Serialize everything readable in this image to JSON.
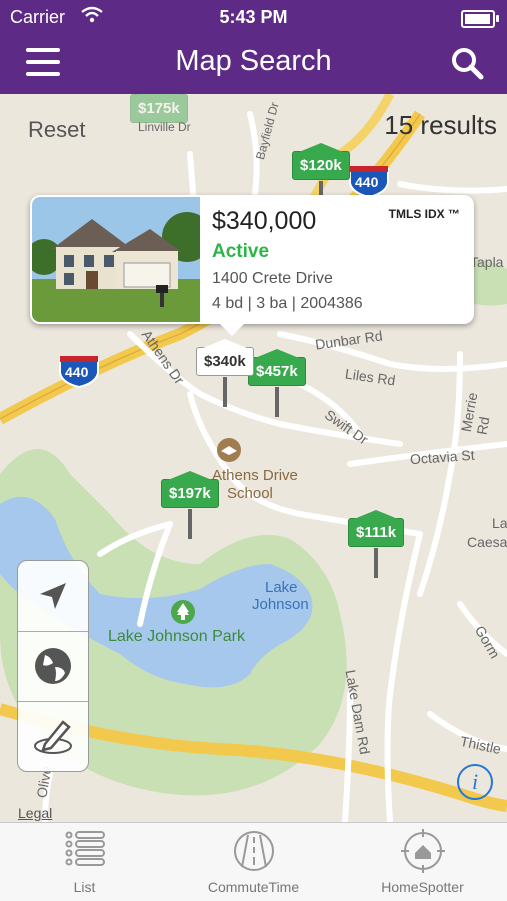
{
  "status_bar": {
    "carrier": "Carrier",
    "time": "5:43 PM",
    "battery_level": 0.95
  },
  "nav": {
    "title": "Map Search",
    "menu_icon": "hamburger-icon",
    "search_icon": "search-icon"
  },
  "map": {
    "reset_label": "Reset",
    "results_label": "15 results",
    "legal_label": "Legal",
    "labels": [
      "Dunbar Rd",
      "Liles Rd",
      "Swift Dr",
      "Octavia St",
      "Athens Dr",
      "Athens Drive",
      "School",
      "Lake",
      "Johnson",
      "Lake Johnson Park",
      "Lake Dam Rd",
      "Merrie Rd",
      "Thistle",
      "Olive",
      "440",
      "440",
      "Lake",
      "Caesa",
      "Tapla",
      "Gorm",
      "Bayfield Dr",
      "Linville Dr"
    ],
    "pins": [
      {
        "label": "$175k",
        "faded": true
      },
      {
        "label": "$120k"
      },
      {
        "label": "$340k",
        "selected": true
      },
      {
        "label": "$457k"
      },
      {
        "label": "$197k"
      },
      {
        "label": "$111k"
      }
    ],
    "popup": {
      "price": "$340,000",
      "brand": "TMLS IDX ™",
      "status": "Active",
      "address": "1400 Crete Drive",
      "details": "4 bd | 3 ba | 2004386"
    }
  },
  "controls": [
    "location-arrow-icon",
    "globe-icon",
    "draw-pencil-icon"
  ],
  "tabs": [
    {
      "label": "List",
      "icon": "list-icon"
    },
    {
      "label": "CommuteTime",
      "icon": "road-icon"
    },
    {
      "label": "HomeSpotter",
      "icon": "target-home-icon"
    }
  ],
  "colors": {
    "nav": "#5d2a86",
    "pin_green": "#39a94e",
    "active_green": "#2db548",
    "info_blue": "#2277d8",
    "highway_yellow": "#f2c94c"
  }
}
